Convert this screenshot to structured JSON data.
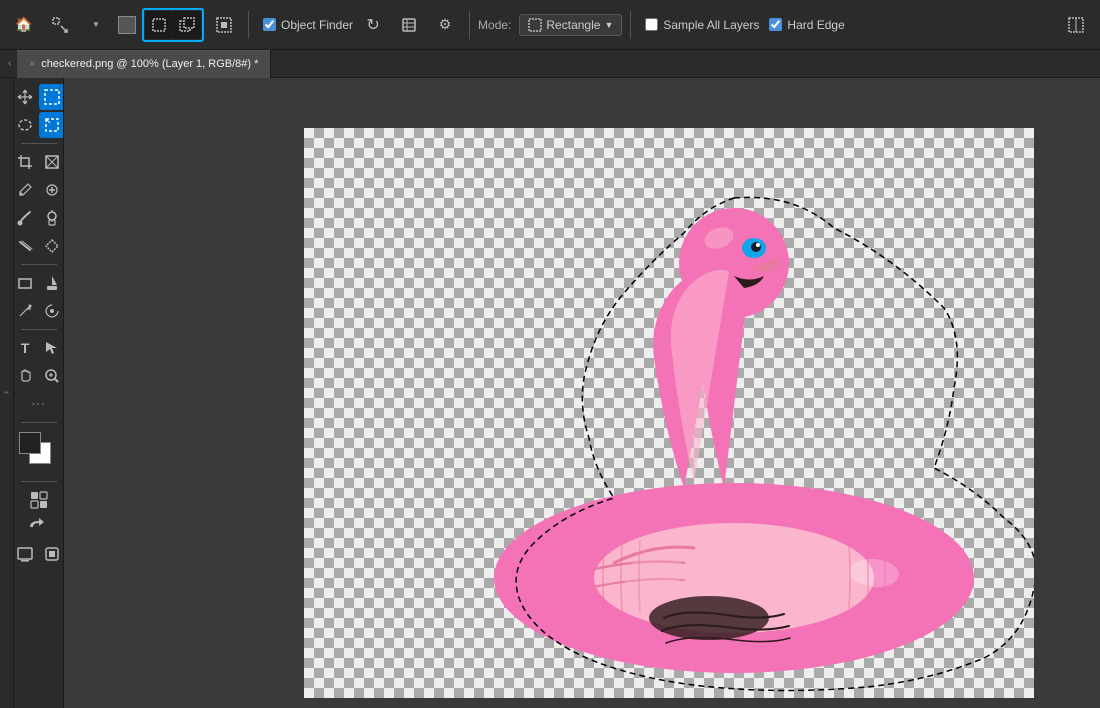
{
  "toolbar": {
    "home_label": "🏠",
    "move_tool": "⬛",
    "object_finder_checked": true,
    "object_finder_label": "Object Finder",
    "refresh_icon": "↻",
    "history_icon": "⧖",
    "settings_icon": "⚙",
    "mode_label": "Mode:",
    "mode_value": "Rectangle",
    "sample_all_layers_checked": false,
    "sample_all_layers_label": "Sample All Layers",
    "hard_edge_checked": true,
    "hard_edge_label": "Hard Edge",
    "expand_icon": "⤢"
  },
  "tab": {
    "title": "checkered.png @ 100% (Layer 1, RGB/8#) *",
    "close_icon": "×"
  },
  "tools": {
    "move": "✥",
    "marquee_rect": "⬚",
    "lasso": "⊙",
    "lasso_rect": "⬜",
    "crop": "⊡",
    "warp": "⊠",
    "eyedropper": "✒",
    "healing": "✿",
    "brush": "✏",
    "stamp": "👤",
    "smudge": "∿",
    "patch": "✦",
    "rect_shape": "□",
    "fill": "◈",
    "pen": "✒",
    "anchor": "⚓",
    "text": "T",
    "select": "↖",
    "hand": "✋",
    "zoom": "🔍",
    "more": "•••"
  },
  "colors": {
    "accent_blue": "#0078d7",
    "toolbar_bg": "#2b2b2b",
    "canvas_bg": "#3a3a3a",
    "foreground": "#222222",
    "background_color": "#ffffff"
  },
  "status": {
    "zoom": "100%"
  }
}
